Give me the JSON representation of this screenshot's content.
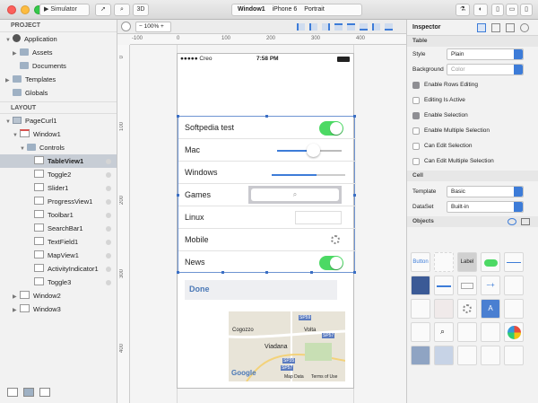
{
  "titlebar": {
    "scheme": "Simulator",
    "btn_3d": "3D",
    "breadcrumbs": [
      "Window1",
      "iPhone 6",
      "Portrait"
    ]
  },
  "project": {
    "header": "PROJECT",
    "items": [
      "Application",
      "Assets",
      "Documents",
      "Templates",
      "Globals"
    ]
  },
  "layout": {
    "header": "LAYOUT",
    "page": "PageCurl1",
    "window": "Window1",
    "controls": "Controls",
    "children": [
      "TableView1",
      "Toggle2",
      "Slider1",
      "ProgressView1",
      "Toolbar1",
      "SearchBar1",
      "TextField1",
      "MapView1",
      "ActivityIndicator1",
      "Toggle3"
    ],
    "windows": [
      "Window2",
      "Window3"
    ]
  },
  "canvas": {
    "zoom": "100%",
    "ruler_h": [
      "-100",
      "0",
      "100",
      "200",
      "300",
      "400"
    ],
    "ruler_v": [
      "0",
      "100",
      "200",
      "300",
      "400"
    ],
    "status": {
      "carrier": "●●●●● Creo",
      "time": "7:58 PM"
    },
    "cells": [
      "Softpedia test",
      "Mac",
      "Windows",
      "Games",
      "Linux",
      "Mobile",
      "News"
    ],
    "done_label": "Done",
    "map": {
      "places": [
        "Cogozzo",
        "Viadana",
        "Volta"
      ],
      "roads": [
        "SP59",
        "SP57",
        "SP35",
        "SP57"
      ],
      "logo": "Google",
      "footer": [
        "Map Data",
        "Terms of Use"
      ]
    }
  },
  "inspector": {
    "title": "Inspector",
    "table_header": "Table",
    "style_label": "Style",
    "style_value": "Plain",
    "background_label": "Background",
    "background_value": "Color",
    "checkboxes": [
      {
        "label": "Enable Rows Editing",
        "checked": true
      },
      {
        "label": "Editing Is Active",
        "checked": false
      },
      {
        "label": "Enable Selection",
        "checked": true
      },
      {
        "label": "Enable Multiple Selection",
        "checked": false
      },
      {
        "label": "Can Edit Selection",
        "checked": false
      },
      {
        "label": "Can Edit Multiple Selection",
        "checked": false
      }
    ],
    "cell_header": "Cell",
    "template_label": "Template",
    "template_value": "Basic",
    "dataset_label": "DataSet",
    "dataset_value": "Built-in",
    "objects_header": "Objects",
    "obj_button": "Button",
    "obj_label": "Label"
  },
  "colors": {
    "accent": "#3d7cd8",
    "toggle_on": "#4cd964",
    "selection": "#c7cdd5"
  }
}
